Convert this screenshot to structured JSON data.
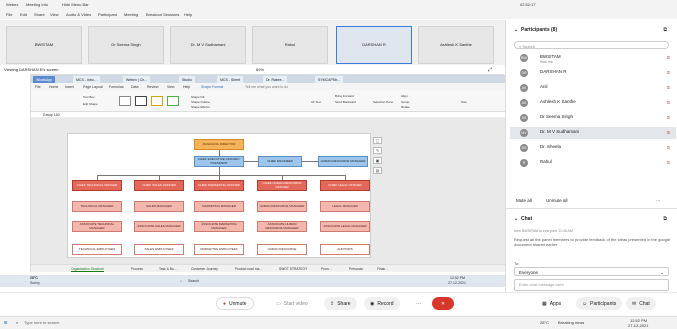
{
  "titlebar": {
    "app": "Webex",
    "meeting": "Meeting Info",
    "hide": "Hide Menu Bar",
    "time": "02:52:17"
  },
  "menubar": {
    "items": [
      "File",
      "Edit",
      "Share",
      "View",
      "Audio & Video",
      "Participant",
      "Meeting",
      "Breakout Sessions",
      "Help"
    ]
  },
  "gallery": {
    "tiles": [
      "BWSITAM",
      "Dr Seema Singh",
      "Dr. M V Sudhamani",
      "Rahul",
      "DARSHAN R",
      "Ashlesh K Santhe"
    ],
    "active_tile": "DARSHAN R"
  },
  "share": {
    "title": "Viewing DARSHAN R's screen",
    "zoom": "69%"
  },
  "ppt": {
    "tabs": [
      "WhatsApp",
      "MCS - Inbo...",
      "Webex | Ch...",
      "Studio",
      "MCS - Sheet",
      "Dr. Rakee...",
      "SYMCAPStr..."
    ],
    "menu": [
      "File",
      "Home",
      "Insert",
      "Page Layout",
      "Formulas",
      "Data",
      "Review",
      "View",
      "Help",
      "Shape Format",
      "Tell me what you want to do"
    ],
    "ribbon": [
      "Text Box",
      "Edit Shape",
      "Shape Fill",
      "Shape Outline",
      "Shape Effects",
      "Alt Text",
      "Bring Forward",
      "Send Backward",
      "Selection Pane",
      "Align",
      "Group",
      "Rotate",
      "Size"
    ],
    "name_box": "Group 140",
    "org": {
      "top": "MANAGING DIRECTOR",
      "ceo": "CHIEF EXECUTIVE OFFICER / PRESIDENT",
      "side1": "CHIEF ENGINEER",
      "side2": "HUMAN RESOURCE MANAGER",
      "heads": [
        "CHIEF TECHNICAL OFFICER",
        "CHIEF SALES OFFICER",
        "CHIEF MARKETING OFFICER",
        "CHIEF HUMAN RESOURCE OFFICER",
        "CHIEF LEGAL OFFICER"
      ],
      "managers": [
        "TECHNICAL MANAGER",
        "SALES MANAGER",
        "MARKETING MANAGER",
        "HUMAN RESOURCE MANAGER",
        "LEGAL MANAGER"
      ],
      "assoc": [
        "ASSOCIATE TECHNICAL MANAGER",
        "ASSOCIATE SALES MANAGER",
        "ASSOCIATE MARKETING MANAGER",
        "ASSOCIATE HUMAN RESOURCE MANAGER",
        "ASSOCIATE LEGAL MANAGER"
      ],
      "employees": [
        "TECHNICAL EMPLOYEES",
        "SALES EMPLOYEES",
        "MARKETING EMPLOYEES",
        "HUMAN RESOURCE",
        "AUDITORS"
      ]
    },
    "sheet_tabs": [
      "Organization Structure",
      "Process",
      "Task & Bu...",
      "Customer Journey",
      "Product road ma...",
      "SWOT STRATEGY",
      "Prom...",
      "Personas",
      "Finan..."
    ]
  },
  "winbar": {
    "weather": "28°C",
    "condition": "Sunny",
    "search": "Search",
    "time": "12:52 PM",
    "date": "27-12-2021"
  },
  "controls": {
    "unmute": "Unmute",
    "start_video": "Start video",
    "share": "Share",
    "record": "Record",
    "apps": "Apps",
    "participants": "Participants",
    "chat": "Chat"
  },
  "hostbar": {
    "search": "Type here to search",
    "weather": "28°C",
    "news": "Breaking news",
    "time": "12:52 PM",
    "date": "27-12-2021"
  },
  "panel": {
    "title": "Participants (8)",
    "search": "Search",
    "participants": [
      {
        "initials": "BW",
        "name": "BWSITAM",
        "sub": "Host, me"
      },
      {
        "initials": "DR",
        "name": "DARSHAN R",
        "sub": ""
      },
      {
        "initials": "AK",
        "name": "Anil",
        "sub": ""
      },
      {
        "initials": "AS",
        "name": "Ashlesh K Santhe",
        "sub": ""
      },
      {
        "initials": "SS",
        "name": "Dr Seema Singh",
        "sub": ""
      },
      {
        "initials": "MV",
        "name": "Dr. M V Sudhamani",
        "sub": ""
      },
      {
        "initials": "DS",
        "name": "Dr. Sheela",
        "sub": ""
      },
      {
        "initials": "R",
        "name": "Rahul",
        "sub": ""
      }
    ],
    "selected_index": 5,
    "mute_all": "Mute all",
    "unmute_all": "Unmute all",
    "chat_title": "Chat",
    "chat_from": "from BWSITAM to everyone    11:46 AM",
    "chat_message": "Request all the panel members to provide feedback of the ideas presented in the google document shared earlier.",
    "to_label": "To:",
    "to_value": "Everyone",
    "chat_placeholder": "Enter chat message here"
  },
  "colors": {
    "accent": "#3b7dd8",
    "mute": "#c0392b",
    "orange": "#f5b45b",
    "blue": "#9ec5eb",
    "red": "#e4685a"
  }
}
